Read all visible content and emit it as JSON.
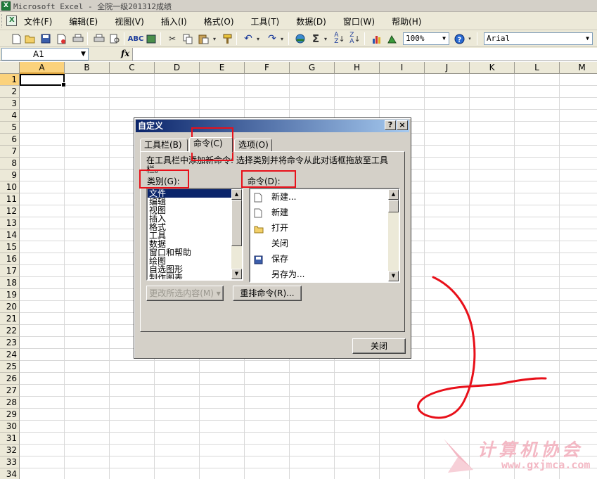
{
  "window": {
    "title": "Microsoft Excel - 全院一级201312成绩"
  },
  "menu": {
    "items": [
      "文件(F)",
      "编辑(E)",
      "视图(V)",
      "插入(I)",
      "格式(O)",
      "工具(T)",
      "数据(D)",
      "窗口(W)",
      "帮助(H)"
    ]
  },
  "toolbar": {
    "zoom": "100%",
    "font": "Arial",
    "icons": [
      "new-icon",
      "open-icon",
      "save-icon",
      "permission-icon",
      "print-icon",
      "print-preview-icon",
      "spelling-icon",
      "research-icon",
      "cut-icon",
      "copy-icon",
      "paste-icon",
      "format-painter-icon",
      "undo-icon",
      "redo-icon",
      "hyperlink-icon",
      "autosum-icon",
      "sort-asc-icon",
      "sort-desc-icon",
      "chart-wizard-icon",
      "drawing-icon",
      "help-icon"
    ]
  },
  "formula_bar": {
    "name_box": "A1",
    "fx": "fx",
    "value": ""
  },
  "grid": {
    "columns": [
      "A",
      "B",
      "C",
      "D",
      "E",
      "F",
      "G",
      "H",
      "I",
      "J",
      "K",
      "L",
      "M"
    ],
    "rows": [
      "1",
      "2",
      "3",
      "4",
      "5",
      "6",
      "7",
      "8",
      "9",
      "10",
      "11",
      "12",
      "13",
      "14",
      "15",
      "16",
      "17",
      "18",
      "19",
      "20",
      "21",
      "22",
      "23",
      "24",
      "25",
      "26",
      "27",
      "28",
      "29",
      "30",
      "31",
      "32",
      "33",
      "34"
    ],
    "active_cell": "A1"
  },
  "dialog": {
    "title": "自定义",
    "help_btn": "?",
    "close_btn": "×",
    "tabs": [
      "工具栏(B)",
      "命令(C)",
      "选项(O)"
    ],
    "selected_tab": "命令(C)",
    "instruction": "在工具栏中添加新命令: 选择类别并将命令从此对话框拖放至工具栏。",
    "categories_label": "类别(G):",
    "commands_label": "命令(D):",
    "categories": [
      "文件",
      "编辑",
      "视图",
      "插入",
      "格式",
      "工具",
      "数据",
      "窗口和帮助",
      "绘图",
      "自选图形",
      "制作图表"
    ],
    "selected_category": "文件",
    "commands": [
      {
        "label": "新建...",
        "icon": "new-document-icon"
      },
      {
        "label": "新建",
        "icon": "new-document-icon"
      },
      {
        "label": "打开",
        "icon": "open-folder-icon"
      },
      {
        "label": "关闭",
        "icon": ""
      },
      {
        "label": "保存",
        "icon": "save-disk-icon"
      },
      {
        "label": "另存为...",
        "icon": ""
      }
    ],
    "modify_selection": "更改所选内容(M) ▾",
    "rearrange": "重排命令(R)...",
    "close": "关闭"
  },
  "watermark": {
    "text": "计算机协会",
    "url": "www.gxjmca.com"
  },
  "annotation_color": "#e8101a"
}
